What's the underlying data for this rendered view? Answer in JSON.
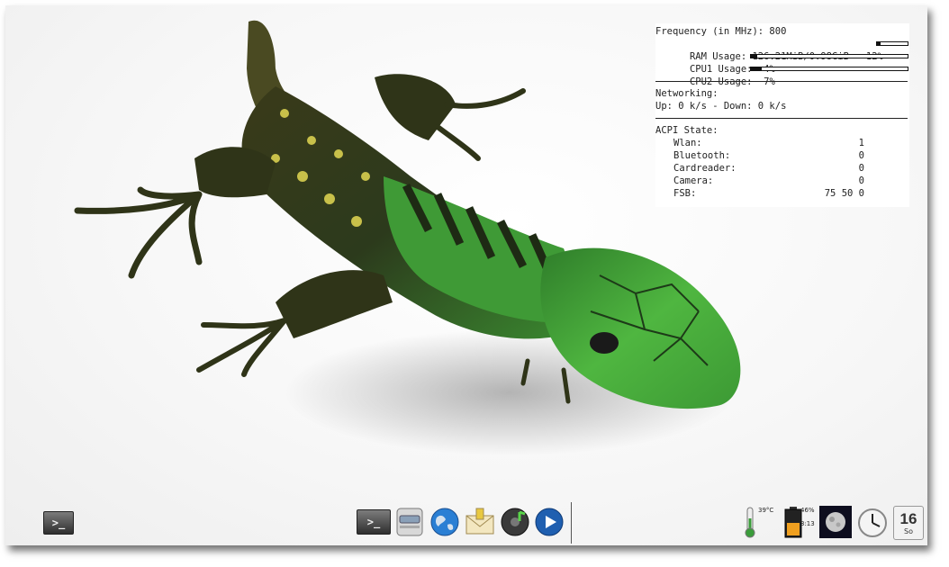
{
  "conky": {
    "frequency": "Frequency (in MHz): 800",
    "ram": "RAM Usage: 126.21MiB/0.98GiB - 12%",
    "ram_percent": 12,
    "cpu1": "CPU1 Usage:  4%",
    "cpu1_percent": 4,
    "cpu2": "CPU2 Usage:  7%",
    "cpu2_percent": 7,
    "networking_title": "Networking:",
    "networking": "Up: 0 k/s - Down: 0 k/s",
    "acpi_title": "ACPI State:",
    "acpi": [
      {
        "label": "Wlan:",
        "value": "1"
      },
      {
        "label": "Bluetooth:",
        "value": "0"
      },
      {
        "label": "Cardreader:",
        "value": "0"
      },
      {
        "label": "Camera:",
        "value": "0"
      },
      {
        "label": "FSB:",
        "value": "75 50 0"
      }
    ]
  },
  "panel": {
    "left_terminal_glyph": ">_",
    "launchers": [
      {
        "name": "terminal-launcher",
        "icon": "terminal-icon",
        "glyph": ">_"
      },
      {
        "name": "file-manager-launcher",
        "icon": "drive-icon"
      },
      {
        "name": "web-browser-launcher",
        "icon": "globe-icon"
      },
      {
        "name": "mail-launcher",
        "icon": "mail-icon"
      },
      {
        "name": "music-player-launcher",
        "icon": "music-icon"
      },
      {
        "name": "media-player-launcher",
        "icon": "play-icon"
      }
    ],
    "tray": {
      "temperature": "39°C",
      "battery_percent": "46%",
      "battery_time": "3:13",
      "calendar_day": "16",
      "calendar_weekday": "So"
    }
  }
}
